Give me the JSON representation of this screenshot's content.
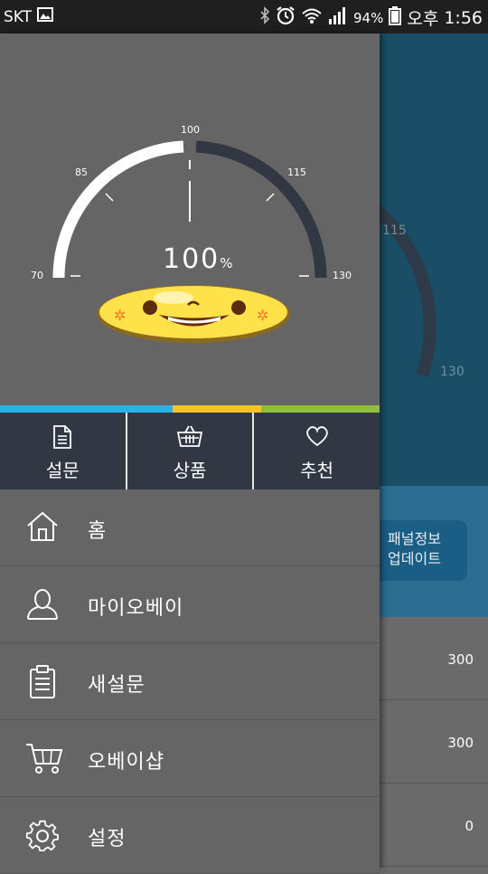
{
  "status_bar": {
    "carrier": "SKT",
    "battery_pct": "94%",
    "ampm": "오후",
    "time": "1:56"
  },
  "gauge": {
    "value_label": "100",
    "unit": "%",
    "value": 100,
    "min": 70,
    "max": 130,
    "ticks": [
      "70",
      "85",
      "100",
      "115",
      "130"
    ]
  },
  "tabs": [
    {
      "label": "설문",
      "icon": "document-icon"
    },
    {
      "label": "상품",
      "icon": "basket-icon"
    },
    {
      "label": "추천",
      "icon": "heart-icon"
    }
  ],
  "menu": [
    {
      "label": "홈",
      "icon": "home-icon"
    },
    {
      "label": "마이오베이",
      "icon": "user-icon"
    },
    {
      "label": "새설문",
      "icon": "clipboard-icon"
    },
    {
      "label": "오베이샵",
      "icon": "cart-icon"
    },
    {
      "label": "설정",
      "icon": "gear-icon"
    }
  ],
  "background_app": {
    "gauge_labels": [
      "115",
      "130"
    ],
    "button_label": "패널정보\n업데이트",
    "button_line1": "패널정보",
    "button_line2": "업데이트",
    "list_values": [
      "300",
      "300",
      "0"
    ]
  },
  "colors": {
    "status_bar": "#1f1f1f",
    "drawer": "#656565",
    "tab_bar": "#313844",
    "gauge_filled": "#ffffff",
    "gauge_track": "#313844",
    "bar_blue": "#29b1e8",
    "bar_yellow": "#f6c22c",
    "bar_green": "#8fbf3b"
  }
}
